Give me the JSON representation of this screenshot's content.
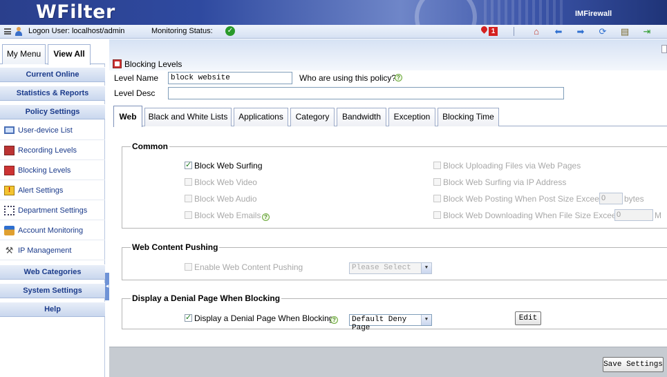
{
  "header": {
    "logo": "WFilter",
    "brand": "IMFirewall"
  },
  "toolbar": {
    "logon_user": "Logon User: localhost/admin",
    "monitoring_status_label": "Monitoring Status:",
    "alert_count": "1"
  },
  "sidebar": {
    "tabs": [
      {
        "label": "My Menu"
      },
      {
        "label": "View All"
      }
    ],
    "sections": [
      "Current Online",
      "Statistics & Reports",
      "Policy Settings",
      "Web Categories",
      "System Settings",
      "Help"
    ],
    "items": [
      {
        "label": "User-device List",
        "icon": "monitor-icon"
      },
      {
        "label": "Recording Levels",
        "icon": "recording-icon"
      },
      {
        "label": "Blocking Levels",
        "icon": "blocking-icon"
      },
      {
        "label": "Alert Settings",
        "icon": "alert-icon"
      },
      {
        "label": "Department Settings",
        "icon": "department-icon"
      },
      {
        "label": "Account Monitoring",
        "icon": "account-icon"
      },
      {
        "label": "IP Management",
        "icon": "ip-management-icon"
      }
    ]
  },
  "main": {
    "title": "Blocking Levels",
    "level_name_label": "Level Name",
    "level_name_value": "block website",
    "who_using_label": "Who are using this policy?",
    "level_desc_label": "Level Desc",
    "level_desc_value": "",
    "tabs": [
      {
        "label": "Web"
      },
      {
        "label": "Black and White Lists"
      },
      {
        "label": "Applications"
      },
      {
        "label": "Category"
      },
      {
        "label": "Bandwidth"
      },
      {
        "label": "Exception"
      },
      {
        "label": "Blocking Time"
      }
    ],
    "common": {
      "legend": "Common",
      "block_web_surfing": "Block Web Surfing",
      "block_web_video": "Block Web Video",
      "block_web_audio": "Block Web Audio",
      "block_web_emails": "Block Web Emails",
      "block_uploading": "Block Uploading Files via Web Pages",
      "block_surfing_ip": "Block Web Surfing via IP Address",
      "block_posting": "Block Web Posting When Post Size Exceeds",
      "post_size_value": "0",
      "post_size_unit": "bytes",
      "block_downloading": "Block Web Downloading When File Size Exceeds",
      "file_size_value": "0",
      "file_size_unit": "M"
    },
    "pushing": {
      "legend": "Web Content Pushing",
      "enable_label": "Enable Web Content Pushing",
      "select_value": "Please Select"
    },
    "denial": {
      "legend": "Display a Denial Page When Blocking",
      "checkbox_label": "Display a Denial Page When Blocking",
      "select_value": "Default Deny Page",
      "edit_label": "Edit"
    },
    "save_label": "Save Settings"
  }
}
